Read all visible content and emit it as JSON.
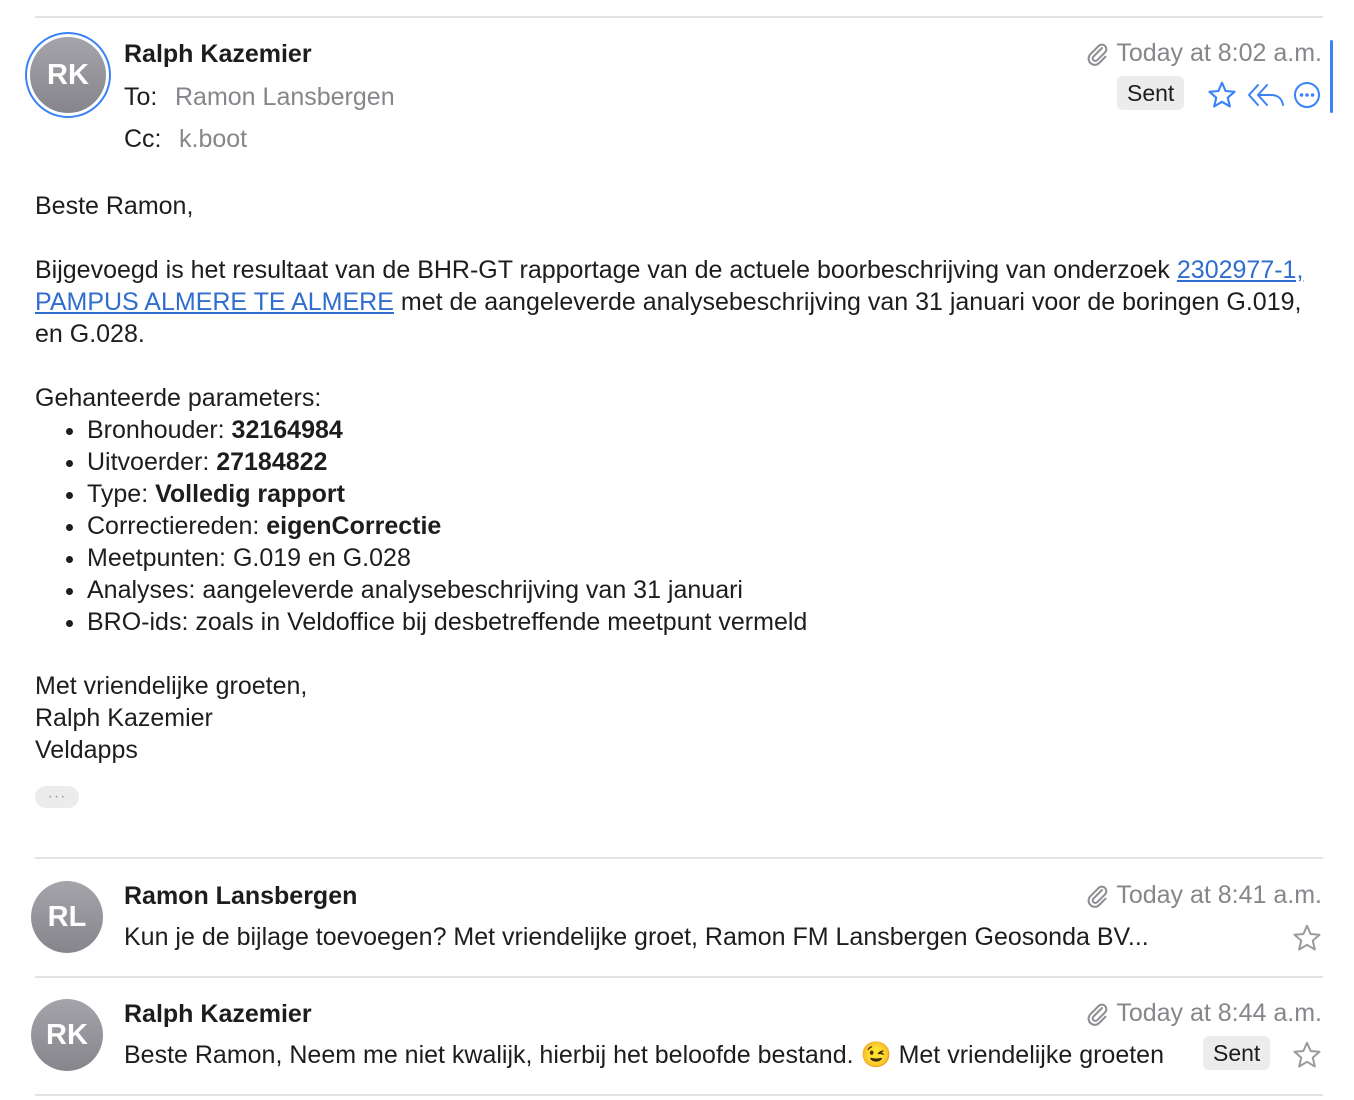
{
  "message1": {
    "avatar_initials": "RK",
    "sender": "Ralph Kazemier",
    "to_label": "To:",
    "to_value": "Ramon Lansbergen",
    "cc_label": "Cc:",
    "cc_value": "k.boot",
    "timestamp": "Today at 8:02 a.m.",
    "badge": "Sent",
    "body": {
      "greeting": "Beste Ramon,",
      "para1_before": "Bijgevoegd is het resultaat van de BHR-GT rapportage van de actuele boorbeschrijving van onderzoek ",
      "para1_link": "2302977-1, PAMPUS ALMERE TE ALMERE",
      "para1_after": " met de aangeleverde analysebeschrijving van 31 januari voor de boringen G.019, en G.028.",
      "params_heading": "Gehanteerde parameters:",
      "params": [
        {
          "label": "Bronhouder: ",
          "value": "32164984",
          "bold": true
        },
        {
          "label": "Uitvoerder: ",
          "value": "27184822",
          "bold": true
        },
        {
          "label": "Type: ",
          "value": "Volledig rapport",
          "bold": true
        },
        {
          "label": "Correctiereden: ",
          "value": "eigenCorrectie",
          "bold": true
        },
        {
          "label": "Meetpunten: ",
          "value": "G.019 en G.028",
          "bold": false
        },
        {
          "label": "Analyses: ",
          "value": "aangeleverde analysebeschrijving van 31 januari",
          "bold": false
        },
        {
          "label": "BRO-ids: ",
          "value": "zoals in Veldoffice bij desbetreffende meetpunt vermeld",
          "bold": false
        }
      ],
      "closing": "Met vriendelijke groeten,",
      "signature_name": "Ralph Kazemier",
      "signature_company": "Veldapps"
    },
    "more_pill": "···"
  },
  "message2": {
    "avatar_initials": "RL",
    "sender": "Ramon Lansbergen",
    "timestamp": "Today at 8:41 a.m.",
    "preview": "Kun je de bijlage toevoegen? Met vriendelijke groet, Ramon FM Lansbergen Geosonda BV..."
  },
  "message3": {
    "avatar_initials": "RK",
    "sender": "Ralph Kazemier",
    "timestamp": "Today at 8:44 a.m.",
    "preview": "Beste Ramon, Neem me niet kwalijk, hierbij het beloofde bestand. 😉 Met vriendelijke groeten",
    "badge": "Sent"
  },
  "colors": {
    "accent": "#3a82f7",
    "link": "#2f6dce",
    "secondary_text": "#86868b",
    "badge_bg": "#ececec"
  },
  "icons": {
    "attachment": "paperclip-icon",
    "flag": "star-icon",
    "reply_all": "reply-all-icon",
    "more": "more-icon"
  }
}
